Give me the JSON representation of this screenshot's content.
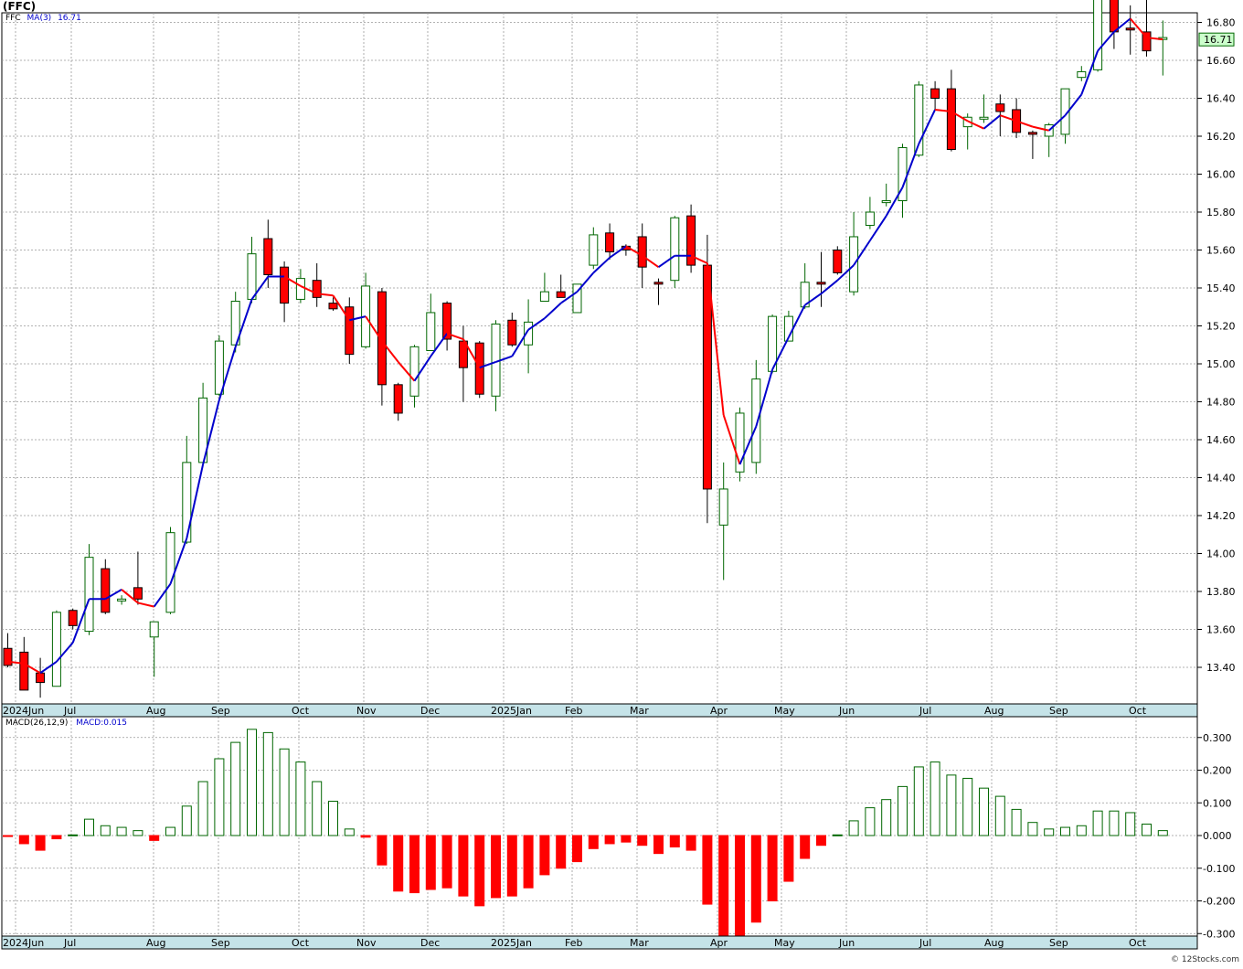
{
  "title": "(FFC)",
  "legend": {
    "symbol": "FFC",
    "ma_label": "MA(3)",
    "ma_value": "16.71"
  },
  "macd_legend": {
    "label": "MACD(26,12,9)",
    "value": "MACD:0.015"
  },
  "price_tag": "16.71",
  "footer": "© 12Stocks.com",
  "colors": {
    "up": "#006600",
    "down": "#ff0000",
    "ma_up": "#0000cc",
    "ma_down": "#ff0000",
    "grid": "#999999",
    "axis_band": "#c5e3e8"
  },
  "chart_data": [
    {
      "type": "candlestick",
      "title": "(FFC)",
      "x_ticks": [
        "2024Jun",
        "Jul",
        "Aug",
        "Sep",
        "Oct",
        "Nov",
        "Dec",
        "2025Jan",
        "Feb",
        "Mar",
        "Apr",
        "May",
        "Jun",
        "Jul",
        "Aug",
        "Sep",
        "Oct"
      ],
      "y_ticks": [
        "13.40",
        "13.60",
        "13.80",
        "14.00",
        "14.20",
        "14.40",
        "14.60",
        "14.80",
        "15.00",
        "15.20",
        "15.40",
        "15.60",
        "15.80",
        "16.00",
        "16.20",
        "16.40",
        "16.60",
        "16.80"
      ],
      "ylim": [
        13.2,
        17.0
      ],
      "grid": true,
      "series": [
        {
          "name": "FFC",
          "ohlc": [
            [
              13.5,
              13.58,
              13.4,
              13.41
            ],
            [
              13.48,
              13.56,
              13.28,
              13.28
            ],
            [
              13.37,
              13.45,
              13.24,
              13.32
            ],
            [
              13.3,
              13.7,
              13.3,
              13.69
            ],
            [
              13.7,
              13.71,
              13.6,
              13.62
            ],
            [
              13.59,
              14.05,
              13.57,
              13.98
            ],
            [
              13.92,
              13.97,
              13.68,
              13.69
            ],
            [
              13.75,
              13.78,
              13.73,
              13.76
            ],
            [
              13.82,
              14.01,
              13.73,
              13.76
            ],
            [
              13.56,
              13.64,
              13.35,
              13.64
            ],
            [
              13.69,
              14.14,
              13.68,
              14.11
            ],
            [
              14.06,
              14.62,
              14.05,
              14.48
            ],
            [
              14.48,
              14.9,
              14.47,
              14.82
            ],
            [
              14.84,
              15.15,
              14.83,
              15.12
            ],
            [
              15.1,
              15.38,
              15.06,
              15.33
            ],
            [
              15.34,
              15.67,
              15.32,
              15.58
            ],
            [
              15.66,
              15.76,
              15.4,
              15.47
            ],
            [
              15.51,
              15.54,
              15.22,
              15.32
            ],
            [
              15.34,
              15.5,
              15.32,
              15.45
            ],
            [
              15.44,
              15.53,
              15.3,
              15.35
            ],
            [
              15.32,
              15.35,
              15.28,
              15.29
            ],
            [
              15.3,
              15.35,
              15.0,
              15.05
            ],
            [
              15.09,
              15.48,
              15.08,
              15.41
            ],
            [
              15.38,
              15.4,
              14.78,
              14.89
            ],
            [
              14.89,
              14.9,
              14.7,
              14.74
            ],
            [
              14.83,
              15.1,
              14.77,
              15.09
            ],
            [
              15.07,
              15.37,
              15.07,
              15.27
            ],
            [
              15.32,
              15.33,
              15.07,
              15.13
            ],
            [
              15.12,
              15.2,
              14.8,
              14.98
            ],
            [
              15.11,
              15.12,
              14.82,
              14.84
            ],
            [
              14.83,
              15.23,
              14.75,
              15.21
            ],
            [
              15.23,
              15.27,
              15.09,
              15.1
            ],
            [
              15.1,
              15.34,
              14.95,
              15.22
            ],
            [
              15.33,
              15.48,
              15.33,
              15.38
            ],
            [
              15.38,
              15.47,
              15.35,
              15.35
            ],
            [
              15.27,
              15.41,
              15.27,
              15.42
            ],
            [
              15.52,
              15.72,
              15.5,
              15.68
            ],
            [
              15.69,
              15.74,
              15.55,
              15.59
            ],
            [
              15.62,
              15.63,
              15.57,
              15.6
            ],
            [
              15.67,
              15.74,
              15.4,
              15.51
            ],
            [
              15.43,
              15.45,
              15.31,
              15.42
            ],
            [
              15.44,
              15.78,
              15.4,
              15.77
            ],
            [
              15.78,
              15.84,
              15.48,
              15.52
            ],
            [
              15.52,
              15.68,
              14.16,
              14.34
            ],
            [
              14.15,
              14.48,
              13.86,
              14.34
            ],
            [
              14.43,
              14.77,
              14.38,
              14.74
            ],
            [
              14.48,
              15.02,
              14.42,
              14.92
            ],
            [
              14.96,
              15.26,
              14.95,
              15.25
            ],
            [
              15.12,
              15.28,
              15.12,
              15.25
            ],
            [
              15.3,
              15.53,
              15.29,
              15.43
            ],
            [
              15.43,
              15.59,
              15.3,
              15.42
            ],
            [
              15.6,
              15.62,
              15.47,
              15.48
            ],
            [
              15.38,
              15.8,
              15.36,
              15.67
            ],
            [
              15.73,
              15.88,
              15.71,
              15.8
            ],
            [
              15.85,
              15.95,
              15.83,
              15.86
            ],
            [
              15.86,
              16.16,
              15.77,
              16.14
            ],
            [
              16.1,
              16.49,
              16.09,
              16.47
            ],
            [
              16.45,
              16.49,
              16.34,
              16.4
            ],
            [
              16.45,
              16.55,
              16.12,
              16.13
            ],
            [
              16.25,
              16.32,
              16.13,
              16.3
            ],
            [
              16.29,
              16.42,
              16.27,
              16.3
            ],
            [
              16.37,
              16.42,
              16.2,
              16.33
            ],
            [
              16.34,
              16.4,
              16.19,
              16.22
            ],
            [
              16.22,
              16.23,
              16.08,
              16.21
            ],
            [
              16.2,
              16.27,
              16.09,
              16.26
            ],
            [
              16.21,
              16.45,
              16.16,
              16.45
            ],
            [
              16.51,
              16.57,
              16.49,
              16.54
            ],
            [
              16.55,
              16.97,
              16.54,
              16.95
            ],
            [
              16.95,
              16.97,
              16.66,
              16.75
            ],
            [
              16.77,
              16.89,
              16.63,
              16.76
            ],
            [
              16.75,
              16.99,
              16.62,
              16.65
            ],
            [
              16.71,
              16.81,
              16.52,
              16.72
            ]
          ]
        },
        {
          "name": "MA(3)",
          "values": [
            13.43,
            13.42,
            13.37,
            13.43,
            13.53,
            13.76,
            13.76,
            13.81,
            13.74,
            13.72,
            13.84,
            14.08,
            14.47,
            14.81,
            15.09,
            15.34,
            15.46,
            15.46,
            15.41,
            15.37,
            15.36,
            15.23,
            15.25,
            15.12,
            15.01,
            14.91,
            15.04,
            15.16,
            15.13,
            14.98,
            15.01,
            15.04,
            15.18,
            15.24,
            15.32,
            15.38,
            15.48,
            15.56,
            15.62,
            15.57,
            15.51,
            15.57,
            15.57,
            15.53,
            14.73,
            14.47,
            14.67,
            14.97,
            15.14,
            15.31,
            15.37,
            15.44,
            15.52,
            15.65,
            15.78,
            15.93,
            16.16,
            16.34,
            16.33,
            16.28,
            16.24,
            16.31,
            16.28,
            16.25,
            16.23,
            16.31,
            16.42,
            16.65,
            16.75,
            16.82,
            16.72,
            16.71
          ]
        }
      ]
    },
    {
      "type": "bar",
      "title": "MACD(26,12,9)",
      "x_ticks": [
        "2024Jun",
        "Jul",
        "Aug",
        "Sep",
        "Oct",
        "Nov",
        "Dec",
        "2025Jan",
        "Feb",
        "Mar",
        "Apr",
        "May",
        "Jun",
        "Jul",
        "Aug",
        "Sep",
        "Oct"
      ],
      "y_ticks": [
        "-0.300",
        "-0.200",
        "-0.100",
        "0.000",
        "0.100",
        "0.200",
        "0.300"
      ],
      "ylim": [
        -0.31,
        0.35
      ],
      "last_value": 0.015,
      "values": [
        -0.003,
        -0.025,
        -0.045,
        -0.01,
        0.002,
        0.05,
        0.03,
        0.025,
        0.015,
        -0.015,
        0.025,
        0.09,
        0.165,
        0.235,
        0.285,
        0.325,
        0.315,
        0.265,
        0.225,
        0.165,
        0.105,
        0.02,
        -0.005,
        -0.09,
        -0.17,
        -0.175,
        -0.165,
        -0.16,
        -0.185,
        -0.215,
        -0.19,
        -0.185,
        -0.16,
        -0.12,
        -0.1,
        -0.08,
        -0.04,
        -0.025,
        -0.02,
        -0.03,
        -0.055,
        -0.035,
        -0.045,
        -0.21,
        -0.33,
        -0.31,
        -0.265,
        -0.2,
        -0.14,
        -0.07,
        -0.03,
        0.002,
        0.045,
        0.085,
        0.11,
        0.15,
        0.21,
        0.225,
        0.185,
        0.175,
        0.145,
        0.12,
        0.08,
        0.04,
        0.02,
        0.025,
        0.03,
        0.075,
        0.075,
        0.07,
        0.035,
        0.015
      ]
    }
  ]
}
